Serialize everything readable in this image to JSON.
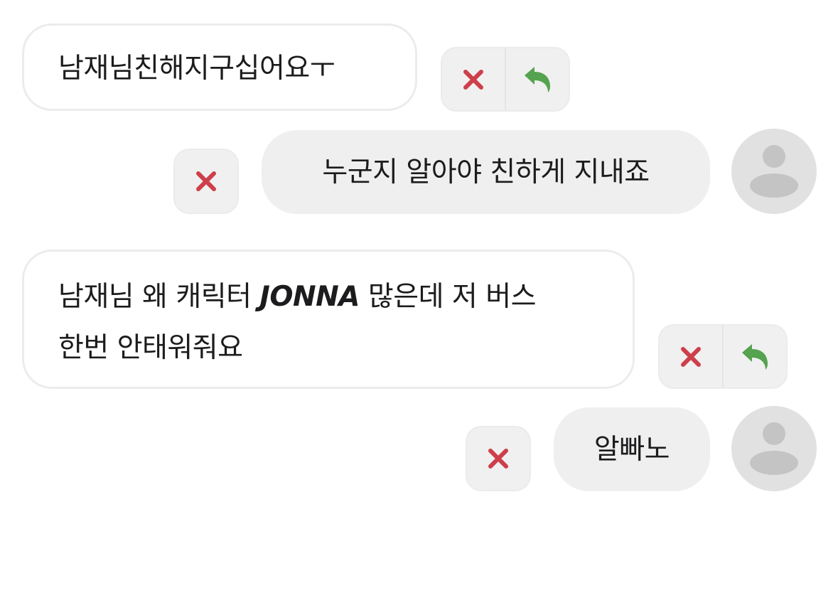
{
  "colors": {
    "delete": "#cd3f4a",
    "reply": "#55a24f",
    "outgoing_bubble": "#efefef",
    "incoming_border": "#ececec",
    "avatar_bg": "#e1e1e1",
    "avatar_fg": "#c4c4c4"
  },
  "messages": [
    {
      "direction": "incoming",
      "text": "남재님친해지구십어요ㅜ",
      "actions": [
        "close-icon",
        "reply-icon"
      ]
    },
    {
      "direction": "outgoing",
      "text": "누군지 알아야 친하게 지내죠",
      "actions": [
        "close-icon"
      ],
      "avatar": "default-user-avatar"
    },
    {
      "direction": "incoming",
      "line1_before": "남재님 왜 캐릭터 ",
      "line1_emphasis": "JONNA",
      "line1_after": " 많은데 저 버스",
      "line2": "한번 안태워줘요",
      "actions": [
        "close-icon",
        "reply-icon"
      ]
    },
    {
      "direction": "outgoing",
      "text": "알빠노",
      "actions": [
        "close-icon"
      ],
      "avatar": "default-user-avatar"
    }
  ]
}
